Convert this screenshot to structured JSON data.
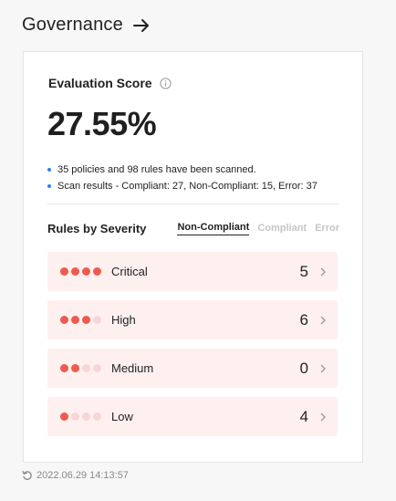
{
  "header": {
    "title": "Governance",
    "arrow_icon": "arrow-right-icon"
  },
  "evaluation": {
    "title": "Evaluation Score",
    "info_icon": "info-icon",
    "score": "27.55%",
    "bullets": [
      "35 policies and 98 rules have been scanned.",
      "Scan results - Compliant: 27, Non-Compliant: 15, Error: 37"
    ]
  },
  "severity": {
    "title": "Rules by Severity",
    "tabs": [
      {
        "label": "Non-Compliant",
        "active": true
      },
      {
        "label": "Compliant",
        "active": false
      },
      {
        "label": "Error",
        "active": false
      }
    ],
    "rows": [
      {
        "label": "Critical",
        "count": "5",
        "level": 4
      },
      {
        "label": "High",
        "count": "6",
        "level": 3
      },
      {
        "label": "Medium",
        "count": "0",
        "level": 2
      },
      {
        "label": "Low",
        "count": "4",
        "level": 1
      }
    ]
  },
  "footer": {
    "timestamp": "2022.06.29 14:13:57",
    "refresh_icon": "refresh-icon"
  },
  "colors": {
    "accent_dot": "#2e7ff5",
    "severity_on": "#ef5a4e",
    "severity_off": "#f8d6d4",
    "row_bg": "#fff0f0"
  }
}
